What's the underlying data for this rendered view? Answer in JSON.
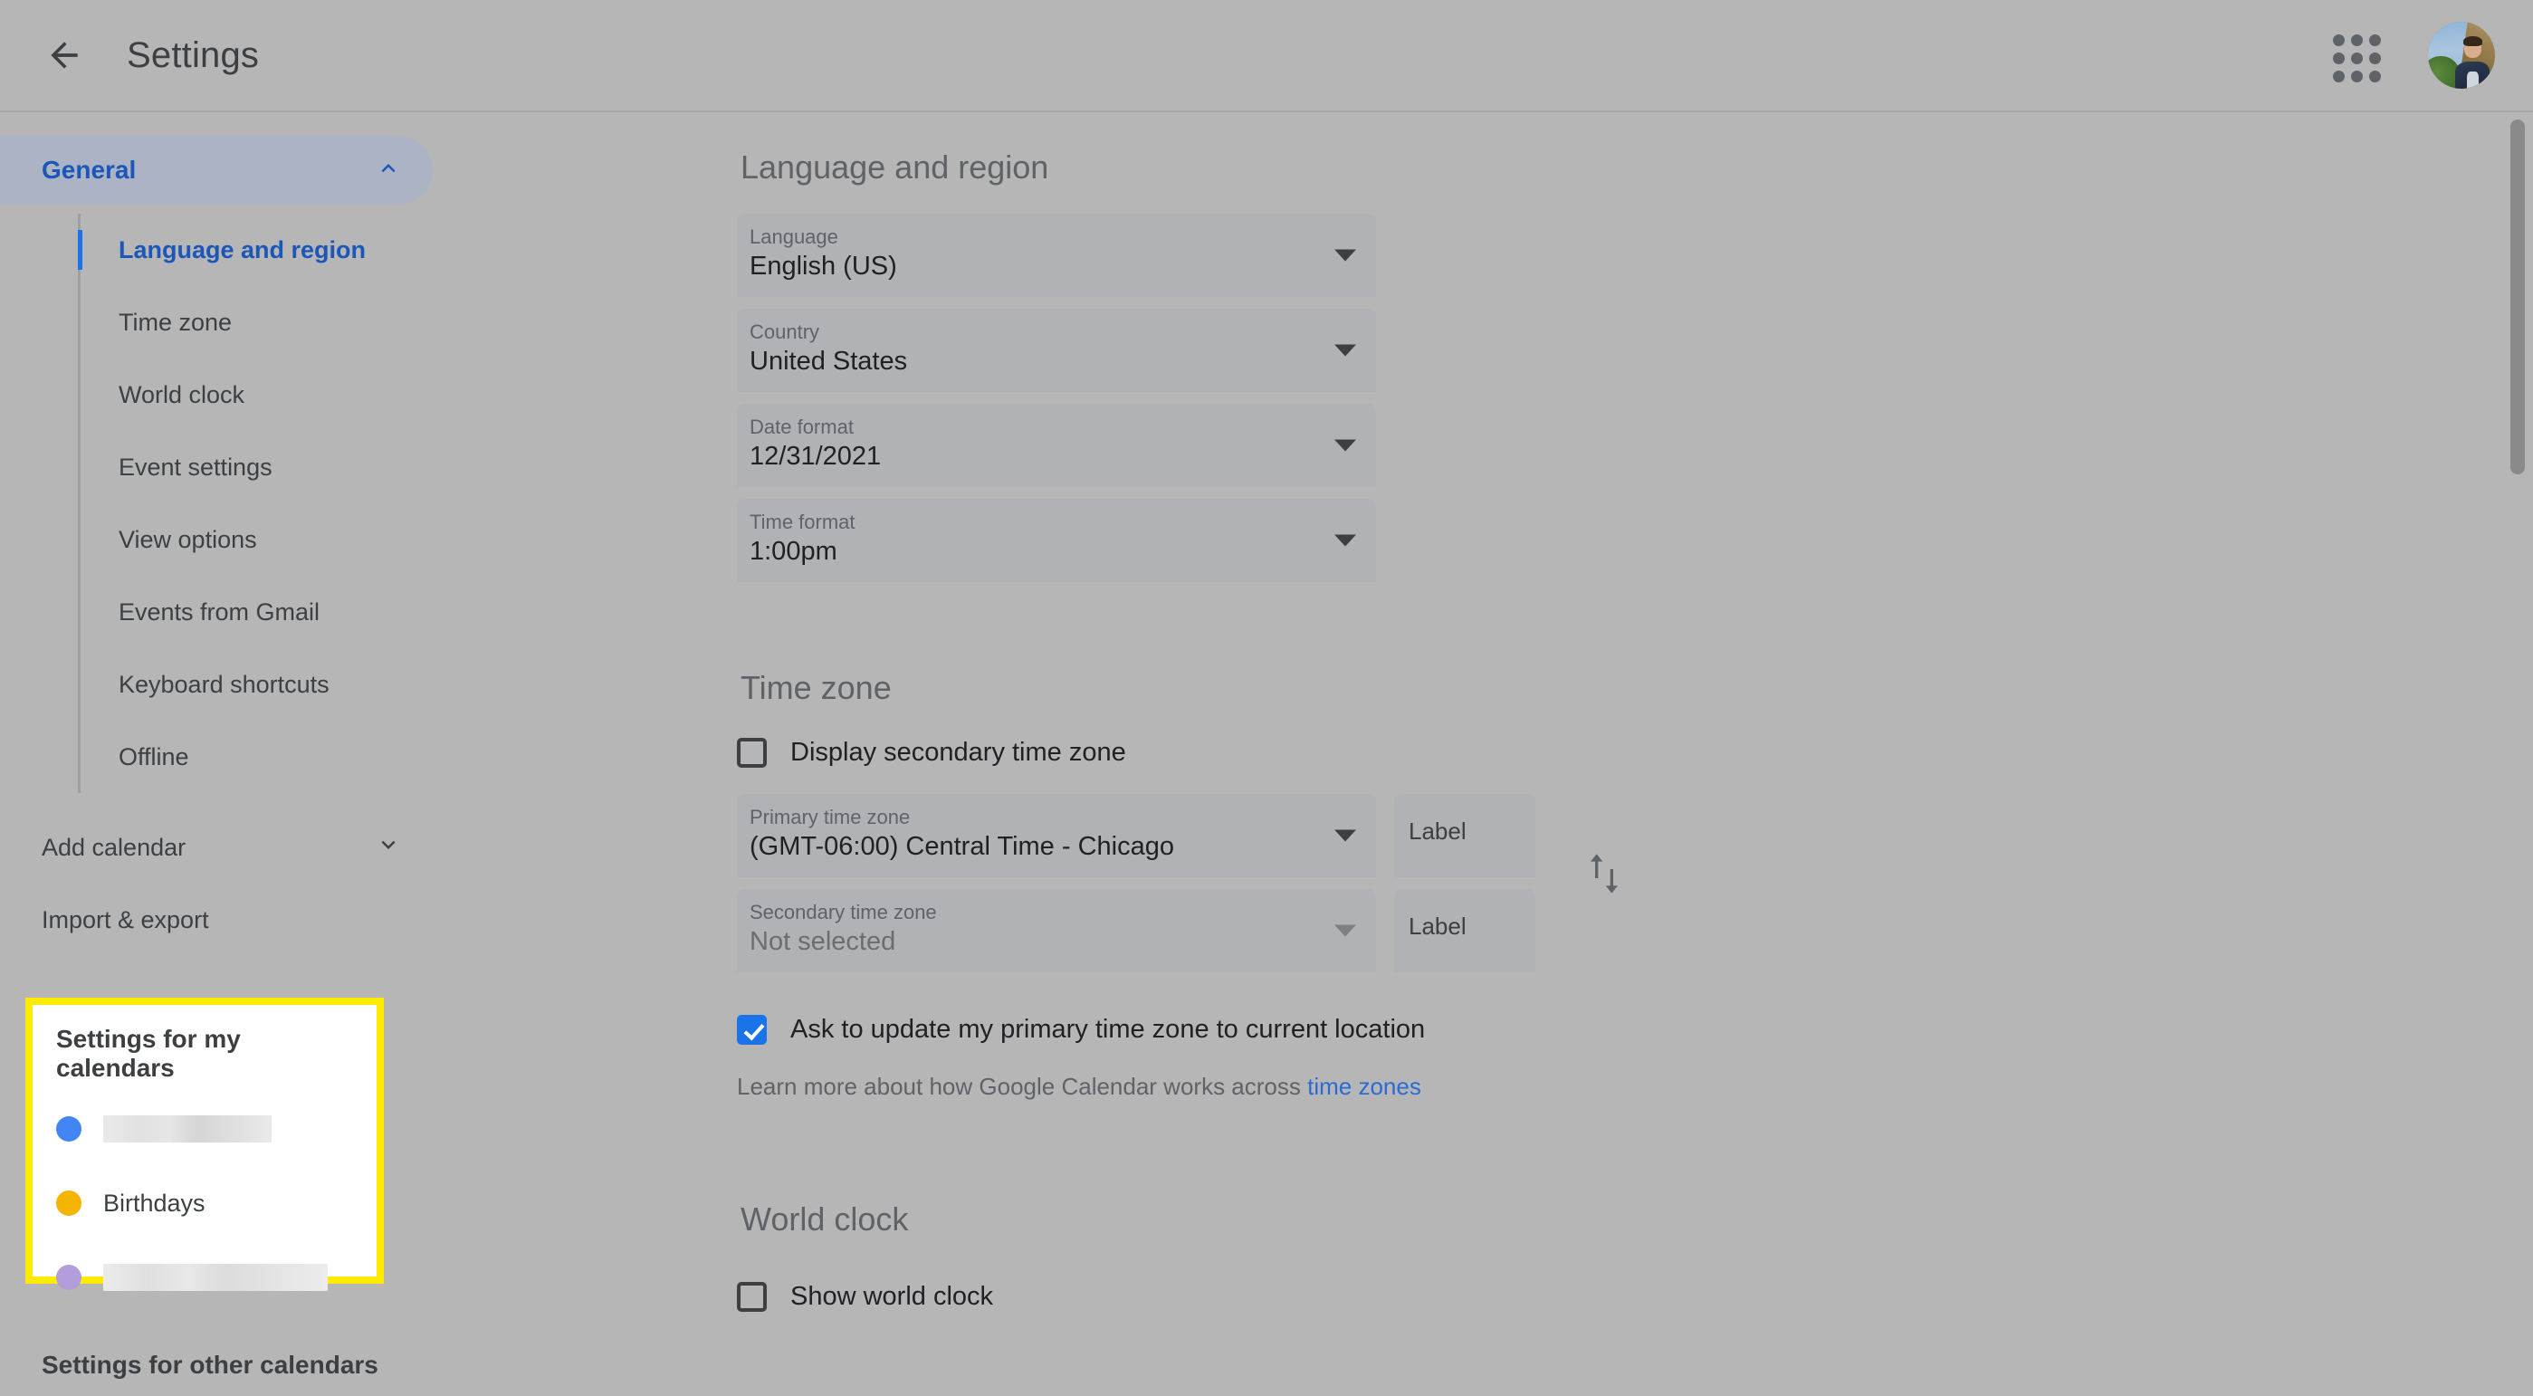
{
  "topbar": {
    "back_icon": "back-arrow-icon",
    "title": "Settings",
    "apps_icon": "apps-grid-icon",
    "avatar_icon": "user-avatar"
  },
  "sidebar": {
    "groups": [
      {
        "label": "General",
        "expanded": true,
        "chevron": "chevron-up-icon",
        "items": [
          {
            "label": "Language and region",
            "selected": true
          },
          {
            "label": "Time zone",
            "selected": false
          },
          {
            "label": "World clock",
            "selected": false
          },
          {
            "label": "Event settings",
            "selected": false
          },
          {
            "label": "View options",
            "selected": false
          },
          {
            "label": "Events from Gmail",
            "selected": false
          },
          {
            "label": "Keyboard shortcuts",
            "selected": false
          },
          {
            "label": "Offline",
            "selected": false
          }
        ]
      }
    ],
    "add_calendar": {
      "label": "Add calendar",
      "chevron": "chevron-down-icon"
    },
    "import_export": {
      "label": "Import & export"
    },
    "other_calendars_title": "Settings for other calendars"
  },
  "highlight": {
    "title": "Settings for my calendars",
    "border_color": "#ffeb00",
    "calendars": [
      {
        "name": "",
        "redacted": true,
        "color": "#4285f4"
      },
      {
        "name": "Birthdays",
        "redacted": false,
        "color": "#f4b400"
      },
      {
        "name": "",
        "redacted": true,
        "color": "#b39ddb"
      }
    ]
  },
  "main": {
    "language_region": {
      "title": "Language and region",
      "fields": [
        {
          "label": "Language",
          "value": "English (US)",
          "muted": false
        },
        {
          "label": "Country",
          "value": "United States",
          "muted": false
        },
        {
          "label": "Date format",
          "value": "12/31/2021",
          "muted": false
        },
        {
          "label": "Time format",
          "value": "1:00pm",
          "muted": false
        }
      ]
    },
    "time_zone": {
      "title": "Time zone",
      "display_secondary": {
        "label": "Display secondary time zone",
        "checked": false
      },
      "primary": {
        "label": "Primary time zone",
        "value": "(GMT-06:00) Central Time - Chicago",
        "muted": false
      },
      "secondary": {
        "label": "Secondary time zone",
        "value": "Not selected",
        "muted": true
      },
      "primary_label_field": "Label",
      "secondary_label_field": "Label",
      "swap_icon": "swap-vertical-icon",
      "ask_update": {
        "label": "Ask to update my primary time zone to current location",
        "checked": true
      },
      "learn_more_prefix": "Learn more about how Google Calendar works across ",
      "learn_more_link": "time zones"
    },
    "world_clock": {
      "title": "World clock",
      "show_world_clock": {
        "label": "Show world clock",
        "checked": false
      }
    }
  }
}
